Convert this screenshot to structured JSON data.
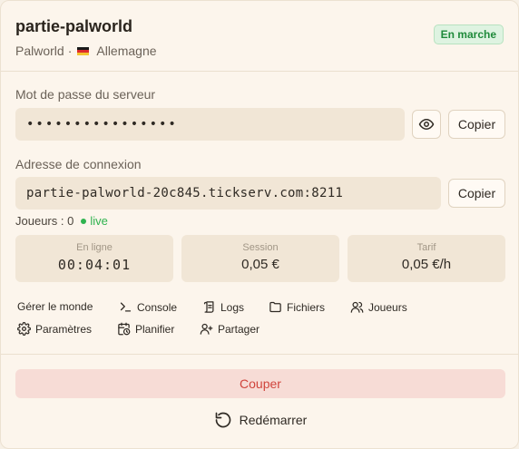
{
  "server": {
    "name": "partie-palworld",
    "game": "Palworld",
    "separator": "·",
    "region": "Allemagne",
    "status": "En marche"
  },
  "password": {
    "label": "Mot de passe du serveur",
    "value": "••••••••••••••••",
    "copy_label": "Copier"
  },
  "connection": {
    "label": "Adresse de connexion",
    "address": "partie-palworld-20c845.tickserv.com:8211",
    "copy_label": "Copier"
  },
  "players": {
    "label": "Joueurs : 0",
    "live": "live"
  },
  "stats": [
    {
      "label": "En ligne",
      "value": "00:04:01"
    },
    {
      "label": "Session",
      "value": "0,05 €"
    },
    {
      "label": "Tarif",
      "value": "0,05 €/h"
    }
  ],
  "actions": {
    "manage_world": "Gérer le monde",
    "console": "Console",
    "logs": "Logs",
    "files": "Fichiers",
    "players": "Joueurs",
    "settings": "Paramètres",
    "schedule": "Planifier",
    "share": "Partager"
  },
  "controls": {
    "stop": "Couper",
    "restart": "Redémarrer"
  },
  "colors": {
    "status_green": "#1f8a3a",
    "danger_red": "#d0443c",
    "field_bg": "#f1e6d6"
  },
  "icons": [
    "eye-icon",
    "terminal-icon",
    "logs-icon",
    "folder-icon",
    "users-icon",
    "gear-icon",
    "calendar-clock-icon",
    "user-plus-icon",
    "restart-icon"
  ]
}
